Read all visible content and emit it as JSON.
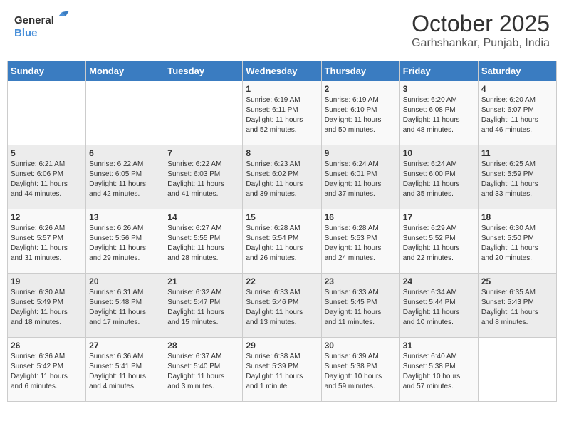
{
  "header": {
    "logo_general": "General",
    "logo_blue": "Blue",
    "month": "October 2025",
    "location": "Garhshankar, Punjab, India"
  },
  "weekdays": [
    "Sunday",
    "Monday",
    "Tuesday",
    "Wednesday",
    "Thursday",
    "Friday",
    "Saturday"
  ],
  "weeks": [
    [
      {
        "day": "",
        "info": ""
      },
      {
        "day": "",
        "info": ""
      },
      {
        "day": "",
        "info": ""
      },
      {
        "day": "1",
        "info": "Sunrise: 6:19 AM\nSunset: 6:11 PM\nDaylight: 11 hours\nand 52 minutes."
      },
      {
        "day": "2",
        "info": "Sunrise: 6:19 AM\nSunset: 6:10 PM\nDaylight: 11 hours\nand 50 minutes."
      },
      {
        "day": "3",
        "info": "Sunrise: 6:20 AM\nSunset: 6:08 PM\nDaylight: 11 hours\nand 48 minutes."
      },
      {
        "day": "4",
        "info": "Sunrise: 6:20 AM\nSunset: 6:07 PM\nDaylight: 11 hours\nand 46 minutes."
      }
    ],
    [
      {
        "day": "5",
        "info": "Sunrise: 6:21 AM\nSunset: 6:06 PM\nDaylight: 11 hours\nand 44 minutes."
      },
      {
        "day": "6",
        "info": "Sunrise: 6:22 AM\nSunset: 6:05 PM\nDaylight: 11 hours\nand 42 minutes."
      },
      {
        "day": "7",
        "info": "Sunrise: 6:22 AM\nSunset: 6:03 PM\nDaylight: 11 hours\nand 41 minutes."
      },
      {
        "day": "8",
        "info": "Sunrise: 6:23 AM\nSunset: 6:02 PM\nDaylight: 11 hours\nand 39 minutes."
      },
      {
        "day": "9",
        "info": "Sunrise: 6:24 AM\nSunset: 6:01 PM\nDaylight: 11 hours\nand 37 minutes."
      },
      {
        "day": "10",
        "info": "Sunrise: 6:24 AM\nSunset: 6:00 PM\nDaylight: 11 hours\nand 35 minutes."
      },
      {
        "day": "11",
        "info": "Sunrise: 6:25 AM\nSunset: 5:59 PM\nDaylight: 11 hours\nand 33 minutes."
      }
    ],
    [
      {
        "day": "12",
        "info": "Sunrise: 6:26 AM\nSunset: 5:57 PM\nDaylight: 11 hours\nand 31 minutes."
      },
      {
        "day": "13",
        "info": "Sunrise: 6:26 AM\nSunset: 5:56 PM\nDaylight: 11 hours\nand 29 minutes."
      },
      {
        "day": "14",
        "info": "Sunrise: 6:27 AM\nSunset: 5:55 PM\nDaylight: 11 hours\nand 28 minutes."
      },
      {
        "day": "15",
        "info": "Sunrise: 6:28 AM\nSunset: 5:54 PM\nDaylight: 11 hours\nand 26 minutes."
      },
      {
        "day": "16",
        "info": "Sunrise: 6:28 AM\nSunset: 5:53 PM\nDaylight: 11 hours\nand 24 minutes."
      },
      {
        "day": "17",
        "info": "Sunrise: 6:29 AM\nSunset: 5:52 PM\nDaylight: 11 hours\nand 22 minutes."
      },
      {
        "day": "18",
        "info": "Sunrise: 6:30 AM\nSunset: 5:50 PM\nDaylight: 11 hours\nand 20 minutes."
      }
    ],
    [
      {
        "day": "19",
        "info": "Sunrise: 6:30 AM\nSunset: 5:49 PM\nDaylight: 11 hours\nand 18 minutes."
      },
      {
        "day": "20",
        "info": "Sunrise: 6:31 AM\nSunset: 5:48 PM\nDaylight: 11 hours\nand 17 minutes."
      },
      {
        "day": "21",
        "info": "Sunrise: 6:32 AM\nSunset: 5:47 PM\nDaylight: 11 hours\nand 15 minutes."
      },
      {
        "day": "22",
        "info": "Sunrise: 6:33 AM\nSunset: 5:46 PM\nDaylight: 11 hours\nand 13 minutes."
      },
      {
        "day": "23",
        "info": "Sunrise: 6:33 AM\nSunset: 5:45 PM\nDaylight: 11 hours\nand 11 minutes."
      },
      {
        "day": "24",
        "info": "Sunrise: 6:34 AM\nSunset: 5:44 PM\nDaylight: 11 hours\nand 10 minutes."
      },
      {
        "day": "25",
        "info": "Sunrise: 6:35 AM\nSunset: 5:43 PM\nDaylight: 11 hours\nand 8 minutes."
      }
    ],
    [
      {
        "day": "26",
        "info": "Sunrise: 6:36 AM\nSunset: 5:42 PM\nDaylight: 11 hours\nand 6 minutes."
      },
      {
        "day": "27",
        "info": "Sunrise: 6:36 AM\nSunset: 5:41 PM\nDaylight: 11 hours\nand 4 minutes."
      },
      {
        "day": "28",
        "info": "Sunrise: 6:37 AM\nSunset: 5:40 PM\nDaylight: 11 hours\nand 3 minutes."
      },
      {
        "day": "29",
        "info": "Sunrise: 6:38 AM\nSunset: 5:39 PM\nDaylight: 11 hours\nand 1 minute."
      },
      {
        "day": "30",
        "info": "Sunrise: 6:39 AM\nSunset: 5:38 PM\nDaylight: 10 hours\nand 59 minutes."
      },
      {
        "day": "31",
        "info": "Sunrise: 6:40 AM\nSunset: 5:38 PM\nDaylight: 10 hours\nand 57 minutes."
      },
      {
        "day": "",
        "info": ""
      }
    ]
  ]
}
